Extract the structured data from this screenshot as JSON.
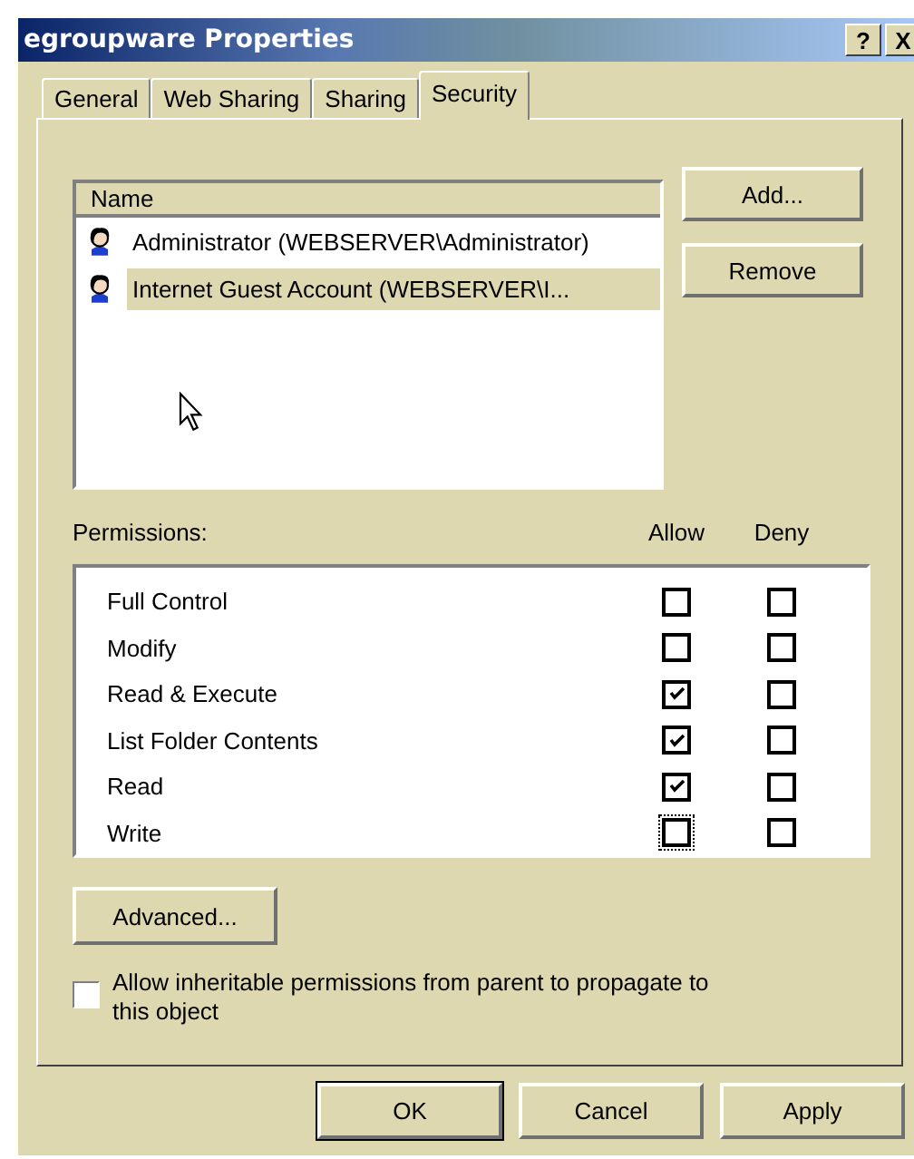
{
  "window": {
    "title": "egroupware Properties",
    "help_glyph": "?",
    "close_glyph": "X"
  },
  "tabs": [
    {
      "label": "General",
      "selected": false
    },
    {
      "label": "Web Sharing",
      "selected": false
    },
    {
      "label": "Sharing",
      "selected": false
    },
    {
      "label": "Security",
      "selected": true
    }
  ],
  "users": {
    "header": "Name",
    "items": [
      {
        "label": "Administrator (WEBSERVER\\Administrator)",
        "selected": false
      },
      {
        "label": "Internet Guest Account (WEBSERVER\\I...",
        "selected": true
      }
    ]
  },
  "user_buttons": [
    "Add...",
    "Remove"
  ],
  "permissions": {
    "label": "Permissions:",
    "allow_header": "Allow",
    "deny_header": "Deny",
    "rows": [
      {
        "name": "Full Control",
        "allow": false,
        "deny": false,
        "focused": false
      },
      {
        "name": "Modify",
        "allow": false,
        "deny": false,
        "focused": false
      },
      {
        "name": "Read & Execute",
        "allow": true,
        "deny": false,
        "focused": false
      },
      {
        "name": "List Folder Contents",
        "allow": true,
        "deny": false,
        "focused": false
      },
      {
        "name": "Read",
        "allow": true,
        "deny": false,
        "focused": false
      },
      {
        "name": "Write",
        "allow": false,
        "deny": false,
        "focused": true
      }
    ]
  },
  "advanced_button": "Advanced...",
  "inherit": {
    "label": "Allow inheritable permissions from parent to propagate to this object",
    "checked": false
  },
  "dialog_buttons": [
    {
      "label": "OK",
      "default": true
    },
    {
      "label": "Cancel",
      "default": false
    },
    {
      "label": "Apply",
      "default": false
    }
  ]
}
